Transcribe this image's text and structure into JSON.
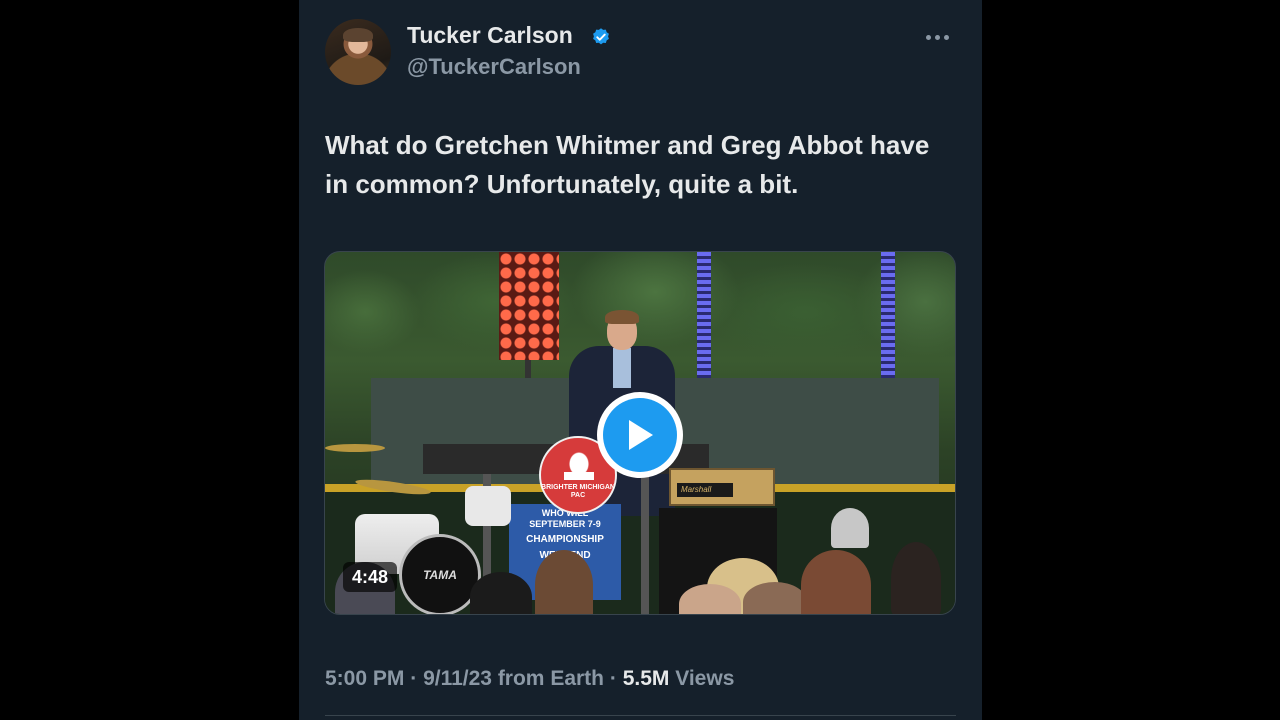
{
  "author": {
    "name": "Tucker Carlson",
    "handle": "@TuckerCarlson",
    "verified": true,
    "avatar_icon": "profile-photo"
  },
  "more_icon": "more-horizontal-icon",
  "tweet": {
    "text": "What do Gretchen Whitmer and Greg Abbot have in common? Unfortunately, quite a bit."
  },
  "media": {
    "type": "video",
    "duration": "4:48",
    "play_icon": "play-icon",
    "logo_text": "BRIGHTER MICHIGAN PAC",
    "sign_lines": [
      "WHO WILL",
      "SEPTEMBER 7-9",
      "CHAMPIONSHIP",
      "WEEKEND"
    ],
    "drum_brand": "TAMA",
    "amp_brand": "Marshall"
  },
  "meta": {
    "time": "5:00 PM",
    "date": "9/11/23",
    "source": "from Earth",
    "separator": "·",
    "views_count": "5.5M",
    "views_label": "Views"
  },
  "colors": {
    "background": "#15202b",
    "accent": "#1d9bf0",
    "text_primary": "#e7e9ea",
    "text_secondary": "#8b98a5"
  }
}
